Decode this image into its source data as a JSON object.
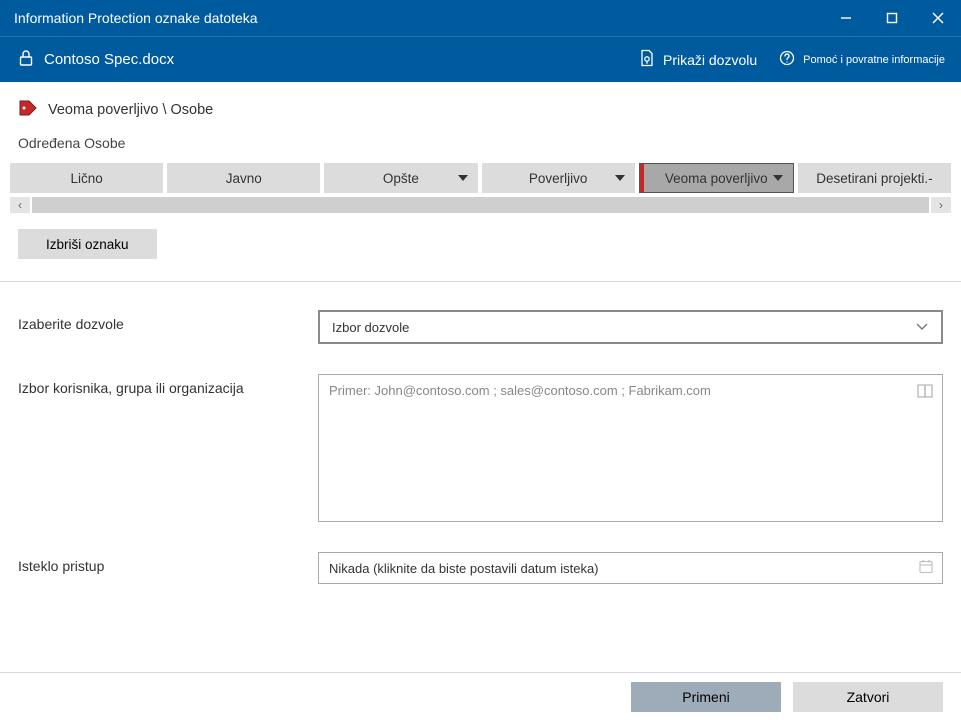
{
  "window": {
    "title": "Information Protection oznake datoteka"
  },
  "header": {
    "filename": "Contoso Spec.docx",
    "show_permission": "Prikaži dozvolu",
    "help_feedback": "Pomoć i povratne informacije"
  },
  "label": {
    "current": "Veoma poverljivo \\ Osobe",
    "section_title": "Određena Osobe"
  },
  "categories": [
    {
      "label": "Lično",
      "has_dropdown": false,
      "selected": false
    },
    {
      "label": "Javno",
      "has_dropdown": false,
      "selected": false
    },
    {
      "label": "Opšte",
      "has_dropdown": true,
      "selected": false
    },
    {
      "label": "Poverljivo",
      "has_dropdown": true,
      "selected": false
    },
    {
      "label": "Veoma poverljivo",
      "has_dropdown": true,
      "selected": true
    },
    {
      "label": "Desetirani projekti.-",
      "has_dropdown": false,
      "selected": false
    }
  ],
  "buttons": {
    "delete_label": "Izbriši oznaku",
    "apply": "Primeni",
    "close": "Zatvori"
  },
  "form": {
    "permissions_label": "Izaberite dozvole",
    "permissions_value": "Izbor dozvole",
    "users_label": "Izbor korisnika, grupa ili organizacija",
    "users_placeholder": "Primer: John@contoso.com ; sales@contoso.com ; Fabrikam.com",
    "expire_label": "Isteklo pristup",
    "expire_value": "Nikada (kliknite da biste postavili datum isteka)"
  },
  "scroll": {
    "left": "‹",
    "right": "›"
  }
}
